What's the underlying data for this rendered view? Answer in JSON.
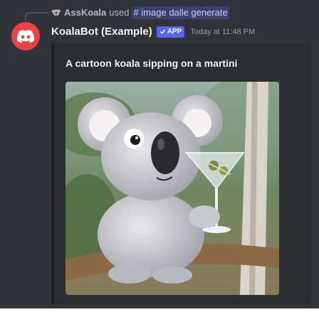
{
  "reply": {
    "user": "AssKoala",
    "action": "used",
    "command": "# image dalle generate"
  },
  "message": {
    "author": "KoalaBot (Example)",
    "badge": "APP",
    "timestamp": "Today at 11:48 PM"
  },
  "embed": {
    "title": "A cartoon koala sipping on a martini",
    "image_alt": "A cartoon koala sipping on a martini"
  },
  "colors": {
    "background": "#313338",
    "embed_background": "#2b2d31",
    "brand_blurple": "#5865f2",
    "avatar_red": "#ed4245"
  },
  "icons": {
    "reply_avatar": "koala-avatar-icon",
    "bot_avatar": "discord-logo-icon",
    "badge_check": "checkmark-icon"
  }
}
